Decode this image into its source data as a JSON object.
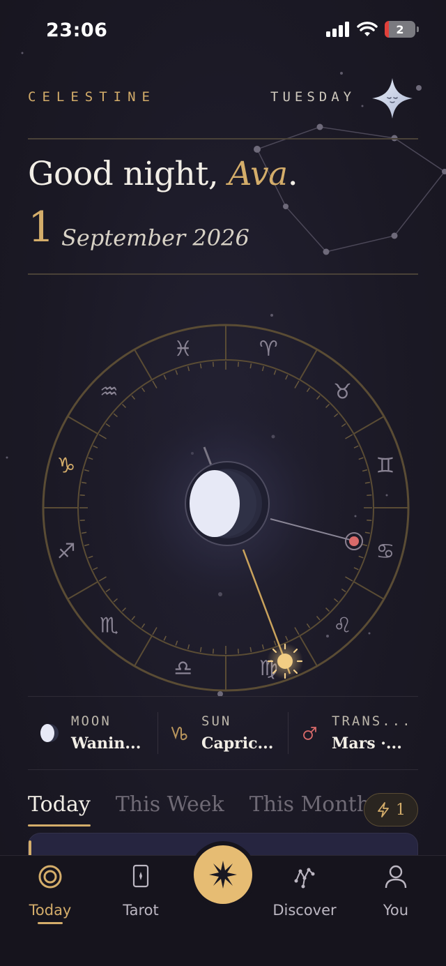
{
  "status": {
    "time": "23:06",
    "battery": "2"
  },
  "header": {
    "brand": "CELESTINE",
    "weekday": "TUESDAY",
    "mascot_icon": "four-point-star-face-icon"
  },
  "greeting": {
    "prefix": "Good night, ",
    "name": "Ava",
    "suffix": "."
  },
  "date": {
    "day": "1",
    "month_year": "September 2026"
  },
  "wheel": {
    "signs": [
      "aries-icon",
      "taurus-icon",
      "gemini-icon",
      "cancer-icon",
      "leo-icon",
      "virgo-icon",
      "libra-icon",
      "scorpio-icon",
      "sagittarius-icon",
      "capricorn-icon",
      "aquarius-icon",
      "pisces-icon"
    ],
    "highlighted_sign": "capricorn-icon",
    "center": "moon-phase-icon"
  },
  "astro": [
    {
      "icon": "moon-icon",
      "label": "MOON",
      "value": "Wanin..."
    },
    {
      "icon": "capricorn-icon",
      "label": "SUN",
      "value": "Capric..."
    },
    {
      "icon": "mars-icon",
      "label": "TRANS...",
      "value": "Mars ·..."
    }
  ],
  "tabs": [
    {
      "label": "Today",
      "active": true
    },
    {
      "label": "This Week",
      "active": false
    },
    {
      "label": "This Month",
      "active": false
    }
  ],
  "streak": {
    "icon": "lightning-icon",
    "count": "1"
  },
  "nav": [
    {
      "label": "Today",
      "icon": "target-icon",
      "active": true
    },
    {
      "label": "Tarot",
      "icon": "tarot-card-icon",
      "active": false
    },
    {
      "label": "",
      "icon": "star-burst-icon",
      "active": false
    },
    {
      "label": "Discover",
      "icon": "constellation-icon",
      "active": false
    },
    {
      "label": "You",
      "icon": "user-icon",
      "active": false
    }
  ],
  "colors": {
    "accent": "#d4ad6a",
    "background": "#1b1925",
    "mars": "#d96a6a"
  }
}
